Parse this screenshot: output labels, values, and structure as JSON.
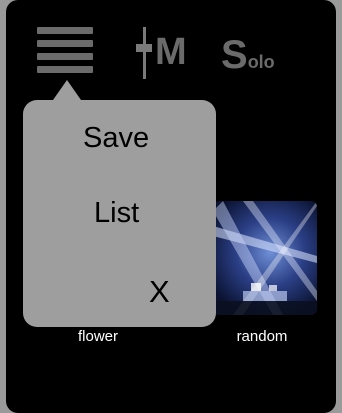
{
  "toolbar": {
    "menu_icon": "hamburger-icon",
    "mixer_letter": "M",
    "solo_big": "S",
    "solo_small": "olo"
  },
  "tiles": [
    {
      "label": "flower"
    },
    {
      "label": "random"
    }
  ],
  "popover_menu": {
    "items": [
      "Save",
      "List",
      "X"
    ]
  },
  "colors": {
    "background": "#000000",
    "toolbar_icon": "#6b6b6b",
    "popover_bg": "#9e9e9e",
    "label_text": "#ffffff"
  }
}
